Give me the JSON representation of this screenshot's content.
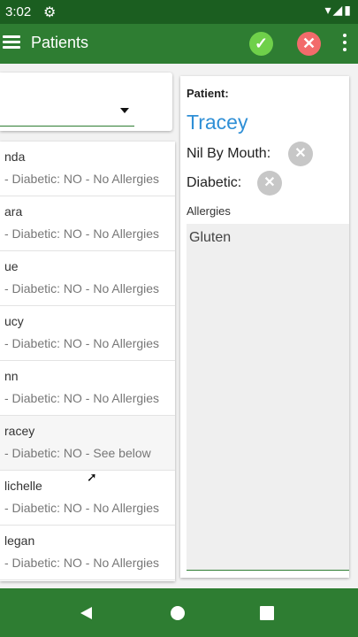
{
  "status_bar": {
    "time": "3:02",
    "gear_icon": "gear-icon",
    "icons": "▾◢▮"
  },
  "app_bar": {
    "title": "Patients",
    "confirm_icon": "check-icon",
    "cancel_icon": "close-icon",
    "more_icon": "more-vert-icon"
  },
  "selector": {
    "value": ""
  },
  "patients": [
    {
      "name": "nda",
      "info": "- Diabetic: NO - No Allergies"
    },
    {
      "name": "ara",
      "info": "- Diabetic: NO - No Allergies"
    },
    {
      "name": "ue",
      "info": "- Diabetic: NO - No Allergies"
    },
    {
      "name": "ucy",
      "info": "- Diabetic: NO - No Allergies"
    },
    {
      "name": "nn",
      "info": "- Diabetic: NO - No Allergies"
    },
    {
      "name": "racey",
      "info": "- Diabetic: NO - See below"
    },
    {
      "name": "lichelle",
      "info": "- Diabetic: NO - No Allergies"
    },
    {
      "name": "legan",
      "info": "- Diabetic: NO - No Allergies"
    }
  ],
  "detail": {
    "patient_label": "Patient:",
    "patient_name": "Tracey",
    "nil_by_mouth_label": "Nil By Mouth:",
    "diabetic_label": "Diabetic:",
    "allergies_label": "Allergies",
    "allergies_value": "Gluten"
  },
  "colors": {
    "primary": "#2e7d32",
    "status_bar": "#1b5e20",
    "accent_name": "#2f8fd6",
    "ok": "#6fd04a",
    "cancel": "#f26b6b"
  }
}
